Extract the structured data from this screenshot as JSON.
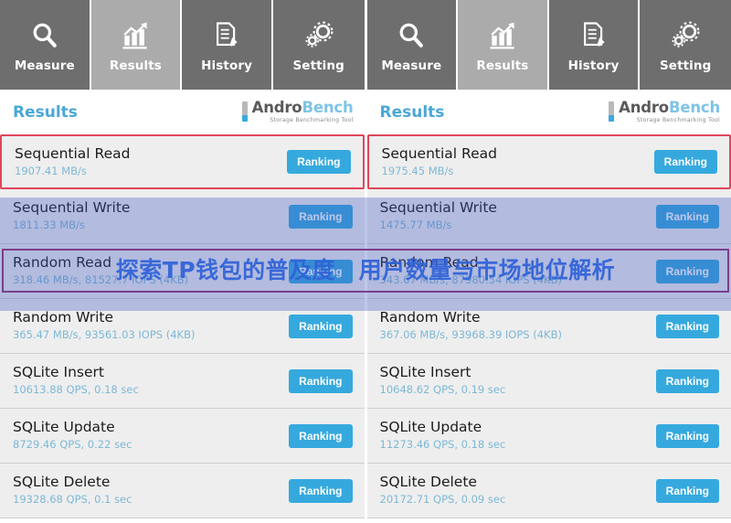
{
  "nav": {
    "items": [
      {
        "label": "Measure",
        "icon": "search-icon",
        "active": false
      },
      {
        "label": "Results",
        "icon": "bar-chart-icon",
        "active": true
      },
      {
        "label": "History",
        "icon": "document-edit-icon",
        "active": false
      },
      {
        "label": "Setting",
        "icon": "gears-icon",
        "active": false
      }
    ]
  },
  "header": {
    "title": "Results",
    "logo_andro": "Andro",
    "logo_bench": "Bench",
    "logo_subtitle": "Storage Benchmarking Tool"
  },
  "ranking_label": "Ranking",
  "overlay": {
    "watermark_text": "探索TP钱包的普及度　用户数量与市场地位解析",
    "watermark_color": "#2f62d8",
    "band_color": "rgba(60,85,190,0.33)",
    "purple_box_color": "#7a3f8c",
    "red_box_color": "#e0455a"
  },
  "colors": {
    "nav_bg": "#6e6e6e",
    "nav_active_bg": "#ababab",
    "title_blue": "#4aa7d8",
    "button_blue": "#35a9de",
    "row_bg": "#eeeeee",
    "sub_text": "#7cb8d6"
  },
  "left_panel": {
    "rows": [
      {
        "title": "Sequential Read",
        "value": "1907.41 MB/s"
      },
      {
        "title": "Sequential Write",
        "value": "1811.33 MB/s"
      },
      {
        "title": "Random Read",
        "value": "318.46 MB/s, 81527.7 IOPS (4KB)"
      },
      {
        "title": "Random Write",
        "value": "365.47 MB/s, 93561.03 IOPS (4KB)"
      },
      {
        "title": "SQLite Insert",
        "value": "10613.88 QPS, 0.18 sec"
      },
      {
        "title": "SQLite Update",
        "value": "8729.46 QPS, 0.22 sec"
      },
      {
        "title": "SQLite Delete",
        "value": "19328.68 QPS, 0.1 sec"
      }
    ]
  },
  "right_panel": {
    "rows": [
      {
        "title": "Sequential Read",
        "value": "1975.45 MB/s"
      },
      {
        "title": "Sequential Write",
        "value": "1475.77 MB/s"
      },
      {
        "title": "Random Read",
        "value": "343.67 MB/s, 87980.54 IOPS (4KB)"
      },
      {
        "title": "Random Write",
        "value": "367.06 MB/s, 93968.39 IOPS (4KB)"
      },
      {
        "title": "SQLite Insert",
        "value": "10648.62 QPS, 0.19 sec"
      },
      {
        "title": "SQLite Update",
        "value": "11273.46 QPS, 0.18 sec"
      },
      {
        "title": "SQLite Delete",
        "value": "20172.71 QPS, 0.09 sec"
      }
    ]
  }
}
